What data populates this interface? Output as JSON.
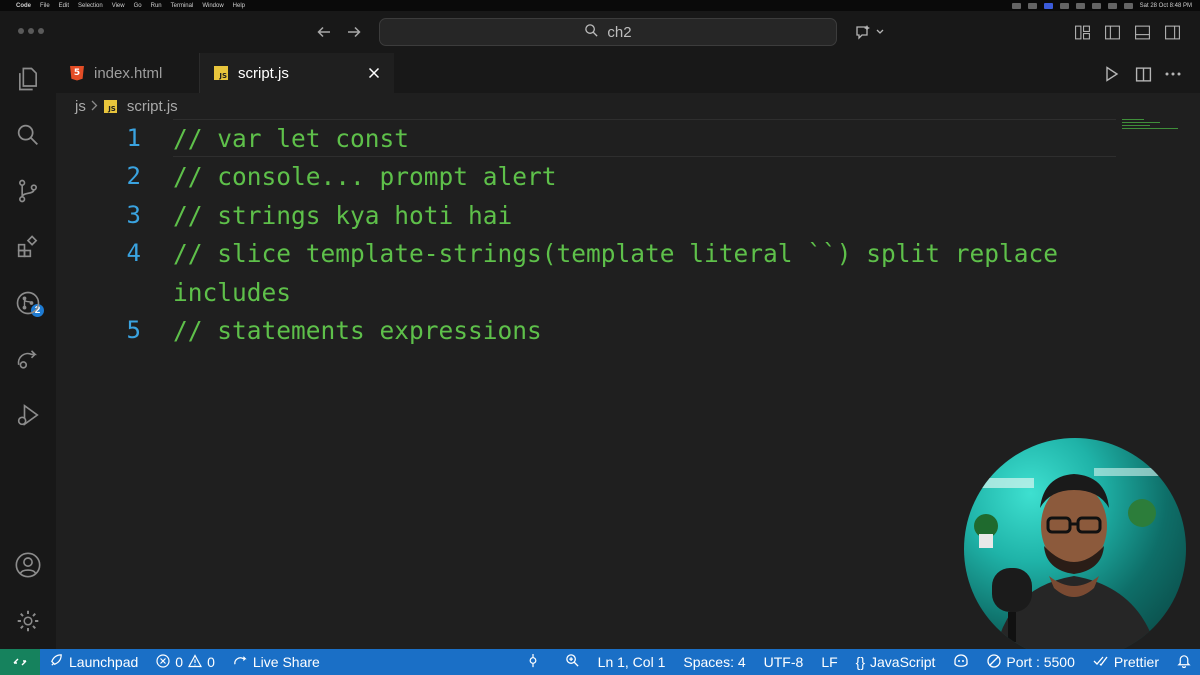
{
  "menubar": {
    "items": [
      "Code",
      "File",
      "Edit",
      "Selection",
      "View",
      "Go",
      "Run",
      "Terminal",
      "Window",
      "Help"
    ],
    "datetime": "Sat 28 Oct  8:48 PM"
  },
  "titlebar": {
    "search_text": "ch2"
  },
  "activity": {
    "extensions_badge": "2"
  },
  "tabs": [
    {
      "label": "index.html",
      "icon": "html5-icon"
    },
    {
      "label": "script.js",
      "icon": "js-icon",
      "active": true
    }
  ],
  "file_icons": {
    "html": "5",
    "js": "JS"
  },
  "breadcrumb": {
    "folder": "js",
    "file": "script.js"
  },
  "editor": {
    "lines": [
      {
        "num": "1",
        "text": "// var let const"
      },
      {
        "num": "2",
        "text": "// console... prompt alert"
      },
      {
        "num": "3",
        "text": "// strings kya hoti hai"
      },
      {
        "num": "4",
        "text": "// slice template-strings(template literal ``) split replace"
      },
      {
        "wrap": "includes"
      },
      {
        "num": "5",
        "text": "// statements expressions"
      }
    ],
    "colors": {
      "comment": "#5ec04a",
      "line_number": "#3aa3e0"
    }
  },
  "statusbar": {
    "launchpad": "Launchpad",
    "errors": "0",
    "warnings": "0",
    "live_share": "Live Share",
    "position": "Ln 1, Col 1",
    "spaces": "Spaces: 4",
    "encoding": "UTF-8",
    "eol": "LF",
    "language": "JavaScript",
    "port": "Port : 5500",
    "prettier": "Prettier",
    "bg_color": "#1a6fc6",
    "remote_color": "#16825d"
  }
}
